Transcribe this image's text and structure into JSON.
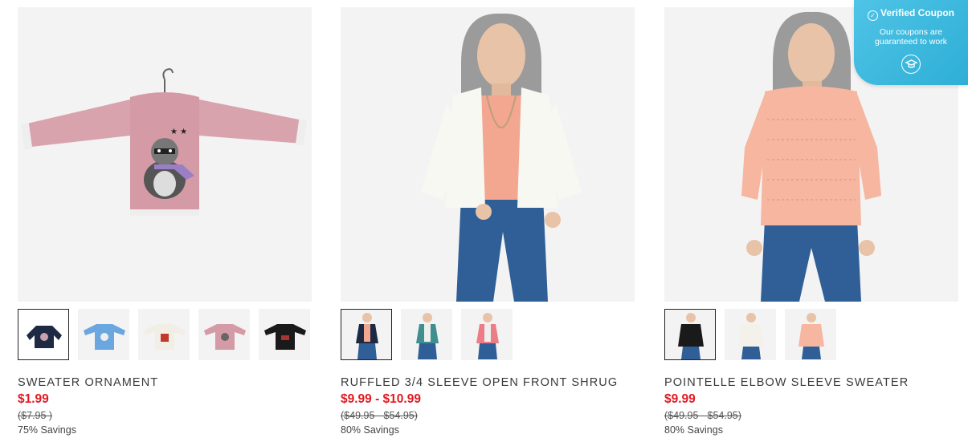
{
  "coupon": {
    "title": "Verified Coupon",
    "subtitle_line1": "Our coupons are",
    "subtitle_line2": "guaranteed to work"
  },
  "products": [
    {
      "title": "SWEATER ORNAMENT",
      "price": "$1.99",
      "original_price": "($7.95 )",
      "savings": "75% Savings",
      "main_image": "pink-sweater-ornament",
      "thumbnails": [
        "navy-hoodie-ornament",
        "blue-sweater-ornament",
        "white-sweater-ornament",
        "pink-sweater-ornament",
        "black-sweater-ornament"
      ]
    },
    {
      "title": "RUFFLED 3/4 SLEEVE OPEN FRONT SHRUG",
      "price": "$9.99 - $10.99",
      "original_price": "($49.95 - $54.95)",
      "savings": "80% Savings",
      "main_image": "model-white-shrug",
      "thumbnails": [
        "model-navy-shrug",
        "model-teal-shrug",
        "model-coral-shrug"
      ]
    },
    {
      "title": "POINTELLE ELBOW SLEEVE SWEATER",
      "price": "$9.99",
      "original_price": "($49.95 - $54.95)",
      "savings": "80% Savings",
      "main_image": "model-peach-sweater",
      "thumbnails": [
        "model-black-sweater",
        "model-white-sweater",
        "model-peach-sweater"
      ]
    }
  ]
}
